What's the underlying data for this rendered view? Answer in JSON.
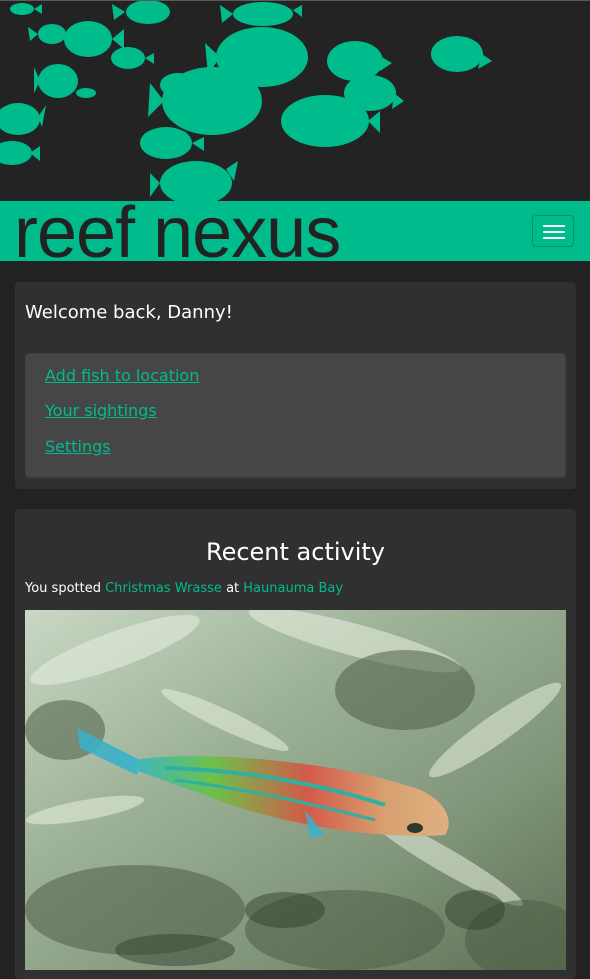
{
  "brand": {
    "name": "reef nexus"
  },
  "nav": {
    "toggle_icon": "hamburger-icon"
  },
  "welcome": {
    "greeting": "Welcome back, Danny!",
    "links": [
      "Add fish to location",
      "Your sightings",
      "Settings"
    ]
  },
  "activity": {
    "title": "Recent activity",
    "prefix": "You spotted",
    "fish": "Christmas Wrasse",
    "joiner": "at",
    "location": "Haunauma Bay",
    "photo_icon": "fish-photo"
  },
  "colors": {
    "accent": "#00bc8c",
    "background": "#222222",
    "panel": "#303030",
    "well": "#464646",
    "text": "#ffffff"
  }
}
